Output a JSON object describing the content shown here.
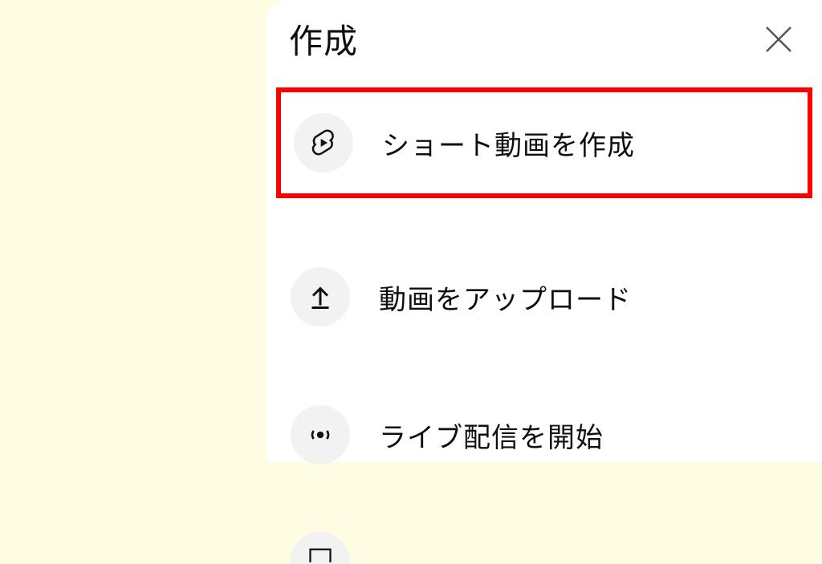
{
  "panel": {
    "title": "作成",
    "options": [
      {
        "label": "ショート動画を作成",
        "icon": "shorts-icon",
        "highlighted": true
      },
      {
        "label": "動画をアップロード",
        "icon": "upload-icon",
        "highlighted": false
      },
      {
        "label": "ライブ配信を開始",
        "icon": "live-icon",
        "highlighted": false
      }
    ]
  }
}
